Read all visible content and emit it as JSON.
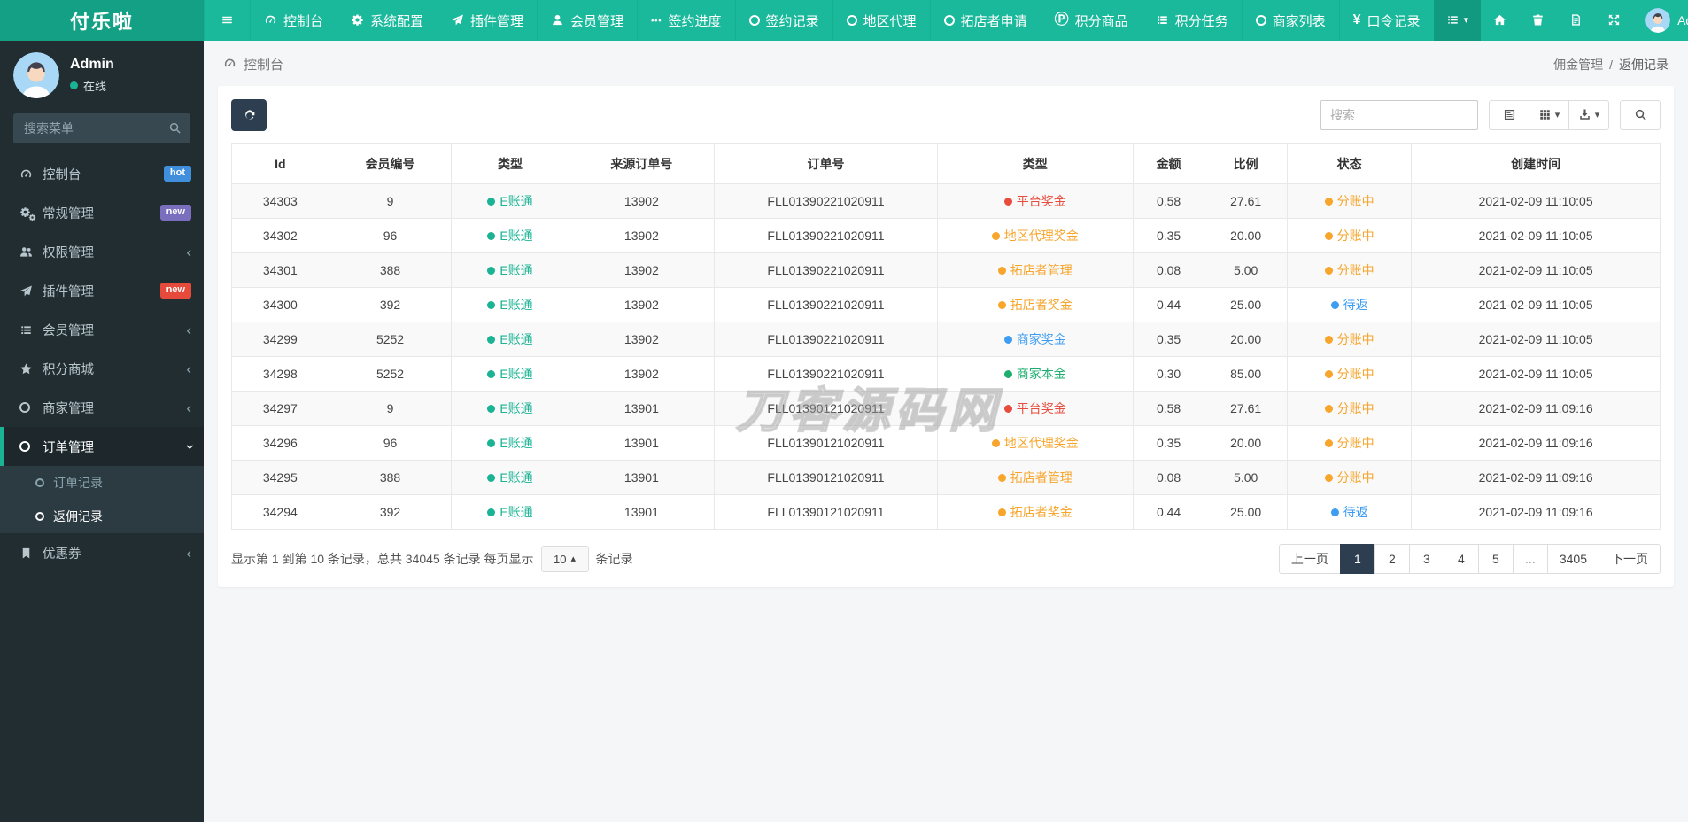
{
  "navbar": {
    "brand": "付乐啦",
    "items": [
      {
        "label": "控制台",
        "icon": "gauge-icon"
      },
      {
        "label": "系统配置",
        "icon": "gear-icon"
      },
      {
        "label": "插件管理",
        "icon": "paper-plane-icon"
      },
      {
        "label": "会员管理",
        "icon": "user-icon"
      },
      {
        "label": "签约进度",
        "icon": "ellipsis-icon"
      },
      {
        "label": "签约记录",
        "icon": "circle-icon"
      },
      {
        "label": "地区代理",
        "icon": "circle-icon"
      },
      {
        "label": "拓店者申请",
        "icon": "circle-icon"
      },
      {
        "label": "积分商品",
        "icon": "circle-p-icon"
      },
      {
        "label": "积分任务",
        "icon": "tasks-icon"
      },
      {
        "label": "商家列表",
        "icon": "circle-icon"
      },
      {
        "label": "口令记录",
        "icon": "yen-icon"
      }
    ],
    "username": "Admin"
  },
  "sidebar": {
    "username": "Admin",
    "status": "在线",
    "search_placeholder": "搜索菜单",
    "items": [
      {
        "label": "控制台",
        "badge": "hot"
      },
      {
        "label": "常规管理",
        "badge": "new"
      },
      {
        "label": "权限管理"
      },
      {
        "label": "插件管理",
        "badge": "new"
      },
      {
        "label": "会员管理"
      },
      {
        "label": "积分商城"
      },
      {
        "label": "商家管理"
      },
      {
        "label": "订单管理",
        "active": true
      },
      {
        "label": "优惠券"
      }
    ],
    "submenu": [
      {
        "label": "订单记录"
      },
      {
        "label": "返佣记录",
        "active": true
      }
    ]
  },
  "breadcrumb": {
    "left": "控制台",
    "right_parent": "佣金管理",
    "separator": "/",
    "right_current": "返佣记录"
  },
  "toolbar": {
    "search_placeholder": "搜索"
  },
  "table": {
    "headers": [
      "Id",
      "会员编号",
      "类型",
      "来源订单号",
      "订单号",
      "类型",
      "金额",
      "比例",
      "状态",
      "创建时间"
    ],
    "rows": [
      {
        "id": "34303",
        "member": "9",
        "type1": {
          "label": "E账通",
          "color": "teal"
        },
        "source_order": "13902",
        "order_no": "FLL01390221020911",
        "type2": {
          "label": "平台奖金",
          "color": "red"
        },
        "amount": "0.58",
        "ratio": "27.61",
        "status": {
          "label": "分账中",
          "color": "orange"
        },
        "created": "2021-02-09 11:10:05"
      },
      {
        "id": "34302",
        "member": "96",
        "type1": {
          "label": "E账通",
          "color": "teal"
        },
        "source_order": "13902",
        "order_no": "FLL01390221020911",
        "type2": {
          "label": "地区代理奖金",
          "color": "orange"
        },
        "amount": "0.35",
        "ratio": "20.00",
        "status": {
          "label": "分账中",
          "color": "orange"
        },
        "created": "2021-02-09 11:10:05"
      },
      {
        "id": "34301",
        "member": "388",
        "type1": {
          "label": "E账通",
          "color": "teal"
        },
        "source_order": "13902",
        "order_no": "FLL01390221020911",
        "type2": {
          "label": "拓店者管理",
          "color": "orange"
        },
        "amount": "0.08",
        "ratio": "5.00",
        "status": {
          "label": "分账中",
          "color": "orange"
        },
        "created": "2021-02-09 11:10:05"
      },
      {
        "id": "34300",
        "member": "392",
        "type1": {
          "label": "E账通",
          "color": "teal"
        },
        "source_order": "13902",
        "order_no": "FLL01390221020911",
        "type2": {
          "label": "拓店者奖金",
          "color": "orange"
        },
        "amount": "0.44",
        "ratio": "25.00",
        "status": {
          "label": "待返",
          "color": "blue"
        },
        "created": "2021-02-09 11:10:05"
      },
      {
        "id": "34299",
        "member": "5252",
        "type1": {
          "label": "E账通",
          "color": "teal"
        },
        "source_order": "13902",
        "order_no": "FLL01390221020911",
        "type2": {
          "label": "商家奖金",
          "color": "blue"
        },
        "amount": "0.35",
        "ratio": "20.00",
        "status": {
          "label": "分账中",
          "color": "orange"
        },
        "created": "2021-02-09 11:10:05"
      },
      {
        "id": "34298",
        "member": "5252",
        "type1": {
          "label": "E账通",
          "color": "teal"
        },
        "source_order": "13902",
        "order_no": "FLL01390221020911",
        "type2": {
          "label": "商家本金",
          "color": "green"
        },
        "amount": "0.30",
        "ratio": "85.00",
        "status": {
          "label": "分账中",
          "color": "orange"
        },
        "created": "2021-02-09 11:10:05"
      },
      {
        "id": "34297",
        "member": "9",
        "type1": {
          "label": "E账通",
          "color": "teal"
        },
        "source_order": "13901",
        "order_no": "FLL01390121020911",
        "type2": {
          "label": "平台奖金",
          "color": "red"
        },
        "amount": "0.58",
        "ratio": "27.61",
        "status": {
          "label": "分账中",
          "color": "orange"
        },
        "created": "2021-02-09 11:09:16"
      },
      {
        "id": "34296",
        "member": "96",
        "type1": {
          "label": "E账通",
          "color": "teal"
        },
        "source_order": "13901",
        "order_no": "FLL01390121020911",
        "type2": {
          "label": "地区代理奖金",
          "color": "orange"
        },
        "amount": "0.35",
        "ratio": "20.00",
        "status": {
          "label": "分账中",
          "color": "orange"
        },
        "created": "2021-02-09 11:09:16"
      },
      {
        "id": "34295",
        "member": "388",
        "type1": {
          "label": "E账通",
          "color": "teal"
        },
        "source_order": "13901",
        "order_no": "FLL01390121020911",
        "type2": {
          "label": "拓店者管理",
          "color": "orange"
        },
        "amount": "0.08",
        "ratio": "5.00",
        "status": {
          "label": "分账中",
          "color": "orange"
        },
        "created": "2021-02-09 11:09:16"
      },
      {
        "id": "34294",
        "member": "392",
        "type1": {
          "label": "E账通",
          "color": "teal"
        },
        "source_order": "13901",
        "order_no": "FLL01390121020911",
        "type2": {
          "label": "拓店者奖金",
          "color": "orange"
        },
        "amount": "0.44",
        "ratio": "25.00",
        "status": {
          "label": "待返",
          "color": "blue"
        },
        "created": "2021-02-09 11:09:16"
      }
    ]
  },
  "footer": {
    "summary_prefix": "显示第 1 到第 10 条记录，总共 34045 条记录 每页显示",
    "page_size": "10",
    "summary_suffix": "条记录"
  },
  "pagination": {
    "items": [
      "上一页",
      "1",
      "2",
      "3",
      "4",
      "5",
      "...",
      "3405",
      "下一页"
    ],
    "active": "1"
  },
  "watermark": "刀客源码网",
  "colors": {
    "navbar": "#1ab99c",
    "brand_bg": "#14a085",
    "sidebar_bg": "#222d32",
    "submenu_bg": "#2c3b41",
    "active_accent": "#1ab394",
    "badge_hot": "#3f8fdc",
    "badge_new_purple": "#7a6fbe",
    "badge_new_red": "#e64a3b",
    "dark_button": "#2c3e50",
    "teal": "#1ab394",
    "red": "#e74c3c",
    "orange": "#f7a52b",
    "blue": "#3d9df3",
    "green": "#1dae6f"
  }
}
